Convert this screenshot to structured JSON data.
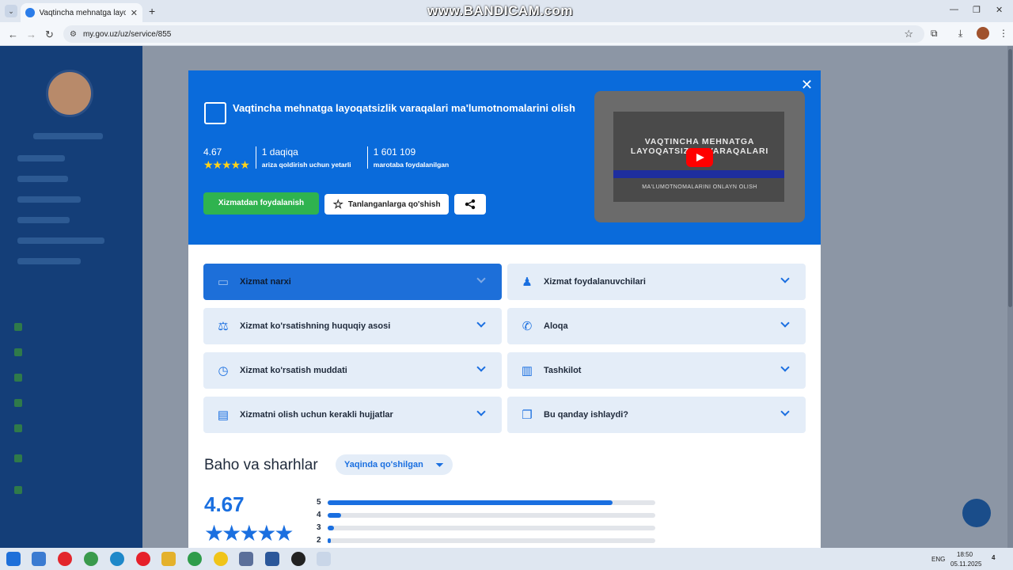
{
  "browser": {
    "tab_title": "Vaqtincha mehnatga layoqatsizlik",
    "url": "my.gov.uz/uz/service/855",
    "watermark": "www.BANDICAM.com"
  },
  "modal": {
    "title": "Vaqtincha mehnatga layoqatsizlik varaqalari ma'lumotnomalarini olish",
    "rating": "4.67",
    "duration": "1 daqiqa",
    "duration_caption": "ariza qoldirish uchun yetarli",
    "uses": "1 601 109",
    "uses_caption": "marotaba foydalanilgan",
    "primary_button": "Xizmatdan foydalanish",
    "favorite_button": "Tanlanganlarga qo'shish",
    "video": {
      "line1": "VAQTINCHA MEHNATGA",
      "line2": "LAYOQATSIZLIK VARAQALARI",
      "line3": "MA'LUMOTNOMALARINI ONLAYN OLISH"
    },
    "accordion": [
      {
        "label": "Xizmat narxi",
        "icon": "credit-card-icon"
      },
      {
        "label": "Xizmat foydalanuvchilari",
        "icon": "person-icon"
      },
      {
        "label": "Xizmat ko'rsatishning huquqiy asosi",
        "icon": "scales-icon"
      },
      {
        "label": "Aloqa",
        "icon": "phone-icon"
      },
      {
        "label": "Xizmat ko'rsatish muddati",
        "icon": "clock-icon"
      },
      {
        "label": "Tashkilot",
        "icon": "building-icon"
      },
      {
        "label": "Xizmatni olish uchun kerakli hujjatlar",
        "icon": "document-icon"
      },
      {
        "label": "Bu qanday ishlaydi?",
        "icon": "chat-icon"
      }
    ],
    "reviews": {
      "heading": "Baho va sharhlar",
      "filter": "Yaqinda qo'shilgan",
      "average": "4.67",
      "distribution": [
        {
          "star": "5",
          "fraction": 0.87
        },
        {
          "star": "4",
          "fraction": 0.04
        },
        {
          "star": "3",
          "fraction": 0.02
        },
        {
          "star": "2",
          "fraction": 0.01
        }
      ]
    }
  },
  "taskbar": {
    "lang": "ENG",
    "time": "18:50",
    "date": "05.11.2025",
    "notif_count": "4"
  }
}
